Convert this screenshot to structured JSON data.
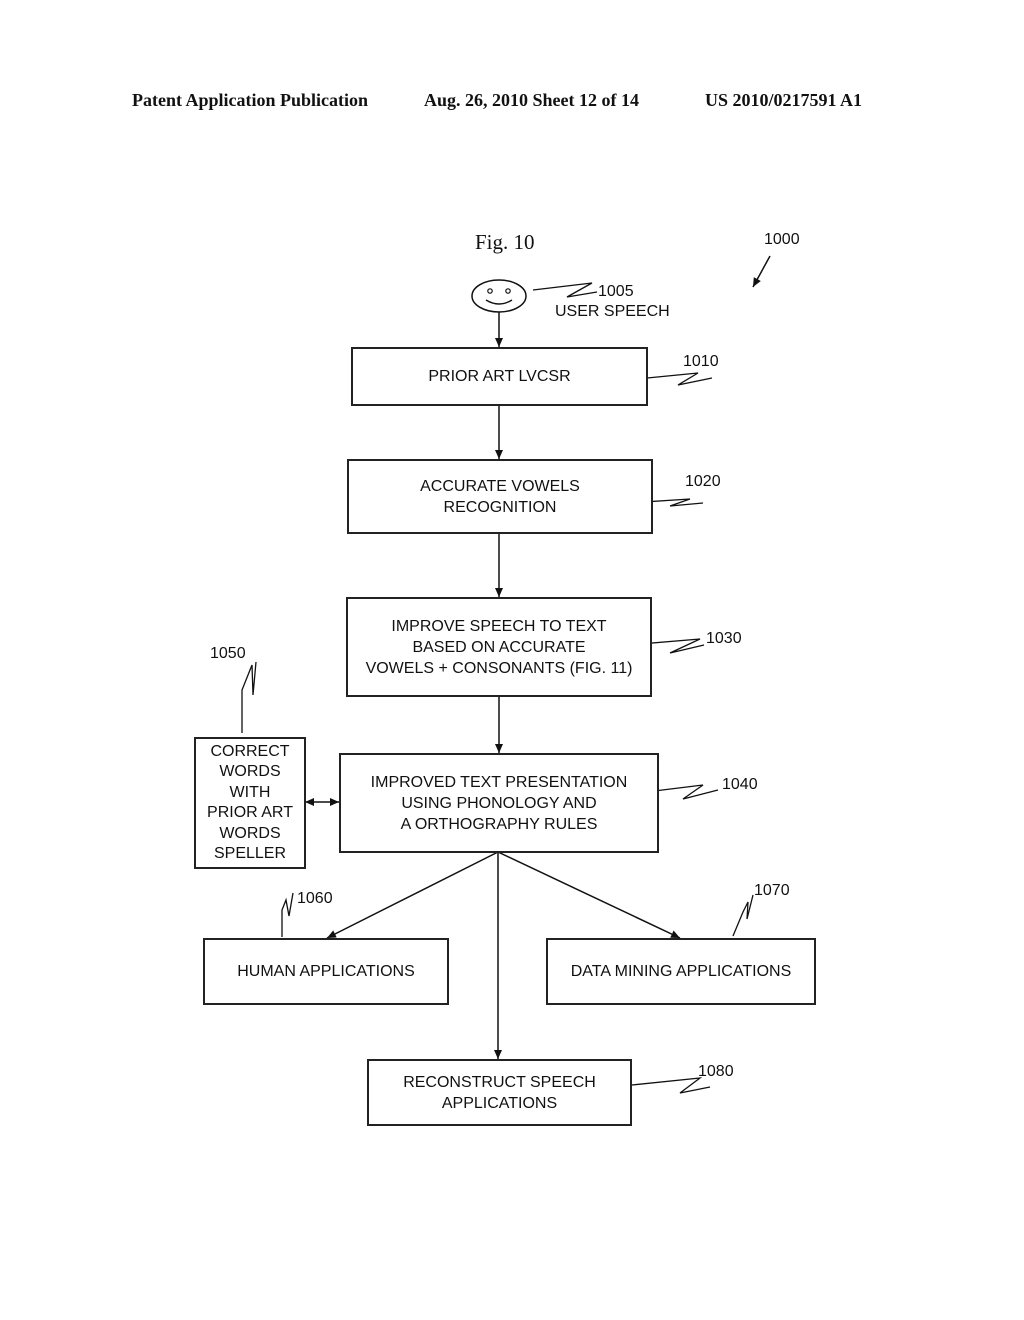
{
  "header": {
    "publication": "Patent Application Publication",
    "date_sheet": "Aug. 26, 2010  Sheet 12 of 14",
    "patent_number": "US 2010/0217591 A1"
  },
  "figure": {
    "title": "Fig. 10",
    "ref_number": "1000"
  },
  "user": {
    "ref": "1005",
    "label": "USER SPEECH"
  },
  "nodes": [
    {
      "id": "1010",
      "ref": "1010",
      "label": "PRIOR ART LVCSR"
    },
    {
      "id": "1020",
      "ref": "1020",
      "label": "ACCURATE VOWELS\nRECOGNITION"
    },
    {
      "id": "1030",
      "ref": "1030",
      "label": "IMPROVE SPEECH TO TEXT\nBASED ON ACCURATE\nVOWELS + CONSONANTS (FIG. 11)"
    },
    {
      "id": "1040",
      "ref": "1040",
      "label": "IMPROVED TEXT PRESENTATION\nUSING PHONOLOGY AND\nA ORTHOGRAPHY RULES"
    },
    {
      "id": "1050",
      "ref": "1050",
      "label": "CORRECT\nWORDS\nWITH\nPRIOR ART\nWORDS\nSPELLER"
    },
    {
      "id": "1060",
      "ref": "1060",
      "label": "HUMAN APPLICATIONS"
    },
    {
      "id": "1070",
      "ref": "1070",
      "label": "DATA MINING APPLICATIONS"
    },
    {
      "id": "1080",
      "ref": "1080",
      "label": "RECONSTRUCT SPEECH\nAPPLICATIONS"
    }
  ],
  "edges": [
    {
      "from": "1005",
      "to": "1010",
      "type": "arrow"
    },
    {
      "from": "1010",
      "to": "1020",
      "type": "arrow"
    },
    {
      "from": "1020",
      "to": "1030",
      "type": "arrow"
    },
    {
      "from": "1030",
      "to": "1040",
      "type": "arrow"
    },
    {
      "from": "1050",
      "to": "1040",
      "type": "bidirectional"
    },
    {
      "from": "1040",
      "to": "1060",
      "type": "arrow"
    },
    {
      "from": "1040",
      "to": "1070",
      "type": "arrow"
    },
    {
      "from": "1040",
      "to": "1080",
      "type": "arrow"
    }
  ]
}
